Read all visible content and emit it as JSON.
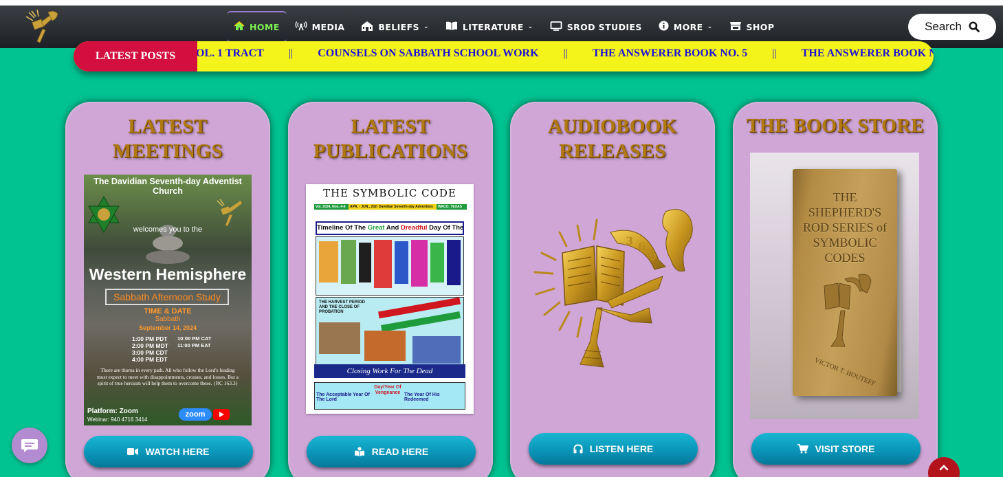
{
  "nav": {
    "items": [
      {
        "label": "HOME",
        "icon": "home-icon",
        "active": true
      },
      {
        "label": "MEDIA",
        "icon": "broadcast-icon"
      },
      {
        "label": "BELIEFS",
        "icon": "beliefs-icon",
        "dropdown": true
      },
      {
        "label": "LITERATURE",
        "icon": "book-icon",
        "dropdown": true
      },
      {
        "label": "SROD STUDIES",
        "icon": "monitor-icon"
      },
      {
        "label": "MORE",
        "icon": "info-icon",
        "dropdown": true
      },
      {
        "label": "SHOP",
        "icon": "store-icon"
      }
    ],
    "search_label": "Search",
    "accent_color": "#7cf050"
  },
  "ticker": {
    "label": "LATEST POSTS",
    "items": [
      "OL. 1 TRACT",
      "COUNSELS ON SABBATH SCHOOL WORK",
      "THE ANSWERER BOOK NO. 5",
      "THE ANSWERER BOOK N"
    ],
    "separator": "||"
  },
  "cards": [
    {
      "title_line1": "LATEST",
      "title_line2": "MEETINGS",
      "button": "WATCH HERE",
      "button_icon": "video-camera-icon"
    },
    {
      "title_line1": "LATEST",
      "title_line2": "PUBLICATIONS",
      "button": "READ HERE",
      "button_icon": "reader-icon"
    },
    {
      "title_line1": "AUDIOBOOK",
      "title_line2": "RELEASES",
      "button": "LISTEN HERE",
      "button_icon": "headphones-icon"
    },
    {
      "title_line1": "THE BOOK STORE",
      "title_line2": "",
      "button": "VISIT STORE",
      "button_icon": "cart-icon"
    }
  ],
  "flyer": {
    "title": "The Davidian Seventh-day Adventist Church",
    "welcome": "welcomes you to the",
    "heading": "Western Hemisphere",
    "subheading": "Sabbath Afternoon Study",
    "time_label": "TIME & DATE",
    "day": "Sabbath",
    "date": "September 14, 2024",
    "times_left": [
      "1:00 PM PDT",
      "2:00 PM MDT",
      "3:00 PM CDT",
      "4:00 PM EDT"
    ],
    "times_right": [
      "10:00 PM CAT",
      "11:00 PM EAT"
    ],
    "quote": "There are thorns in every path. All who follow the Lord's leading must expect to meet with disappointments, crosses, and losses. But a spirit of true heroism will help them to overcome these. {RC 163.3}",
    "platform": "Platform: Zoom",
    "webinar": "Webinar: 940 4716 3414",
    "zoom_label": "zoom"
  },
  "cover": {
    "heading": "THE SYMBOLIC CODE",
    "strip_left": "Vol. 2024, Nos. 4-6",
    "strip_mid": "APR. - JUN., 2024",
    "strip_right": "Davidian Seventh-day Adventists",
    "strip_far": "WACO, TEXAS",
    "band_text": "Timeline Of The Great And Dreadful Day Of The Lord",
    "band_word_great": "Great",
    "band_word_dreadful": "Dreadful",
    "harvest_text": "THE HARVEST PERIOD AND THE CLOSE OF PROBATION",
    "closing_text": "Closing Work For The Dead",
    "foot_left": "The Acceptable Year Of The Lord",
    "foot_mid": "Day/Year Of Vengeance",
    "foot_right": "The Year Of His Redeemed"
  },
  "book": {
    "title": "THE SHEPHERD'S ROD SERIES of SYMBOLIC CODES",
    "author": "VICTOR T. HOUTEFF"
  },
  "colors": {
    "background": "#00c391",
    "card": "#cfa6d6",
    "title_gold": "#b07a10",
    "ticker_yellow": "#f4f41a",
    "ticker_red": "#d20f3e",
    "ticker_text": "#1d10d8",
    "button_teal": "#0a95b8"
  }
}
